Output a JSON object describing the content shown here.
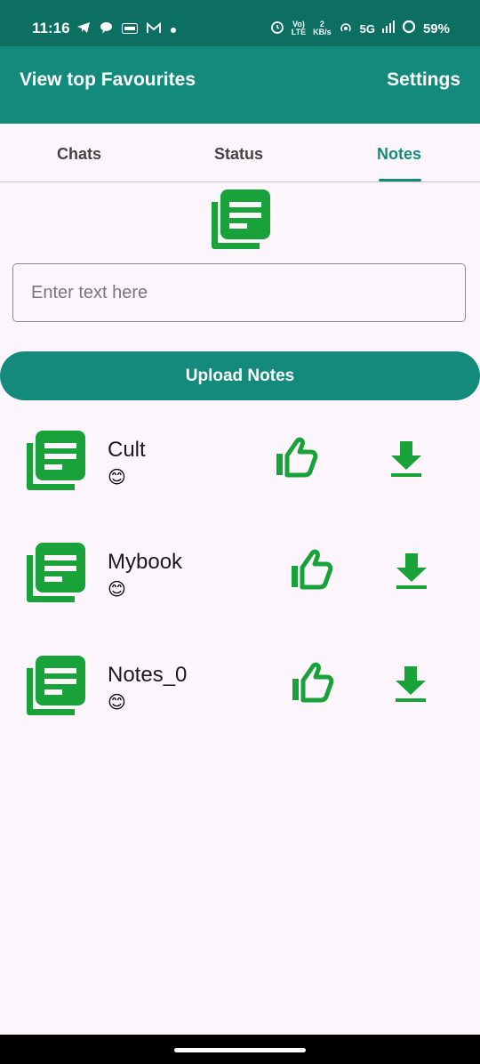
{
  "status_bar": {
    "time": "11:16",
    "battery": "59%",
    "network": "5G",
    "speed_value": "2",
    "speed_unit": "KB/s",
    "volte_top": "Vo)",
    "volte_bottom": "LTE",
    "icons": [
      "telegram-icon",
      "chat-bubble-icon",
      "app-badge-icon",
      "gmail-icon",
      "dot-icon",
      "alarm-icon",
      "volte-icon",
      "hotspot-icon",
      "signal-icon",
      "battery-ring-icon"
    ]
  },
  "app_bar": {
    "title": "View top Favourites",
    "settings_label": "Settings",
    "background": "#148a7d"
  },
  "tabs": [
    {
      "label": "Chats",
      "active": false
    },
    {
      "label": "Status",
      "active": false
    },
    {
      "label": "Notes",
      "active": true
    }
  ],
  "input": {
    "placeholder": "Enter text here",
    "value": ""
  },
  "upload_button": {
    "label": "Upload Notes"
  },
  "notes": [
    {
      "title": "Cult",
      "emoji": "😊"
    },
    {
      "title": "Mybook",
      "emoji": "😊"
    },
    {
      "title": "Notes_0",
      "emoji": "😊"
    }
  ],
  "colors": {
    "accent": "#148a7d",
    "icon_green": "#1aa23a",
    "page_bg": "#fcf6fc"
  }
}
